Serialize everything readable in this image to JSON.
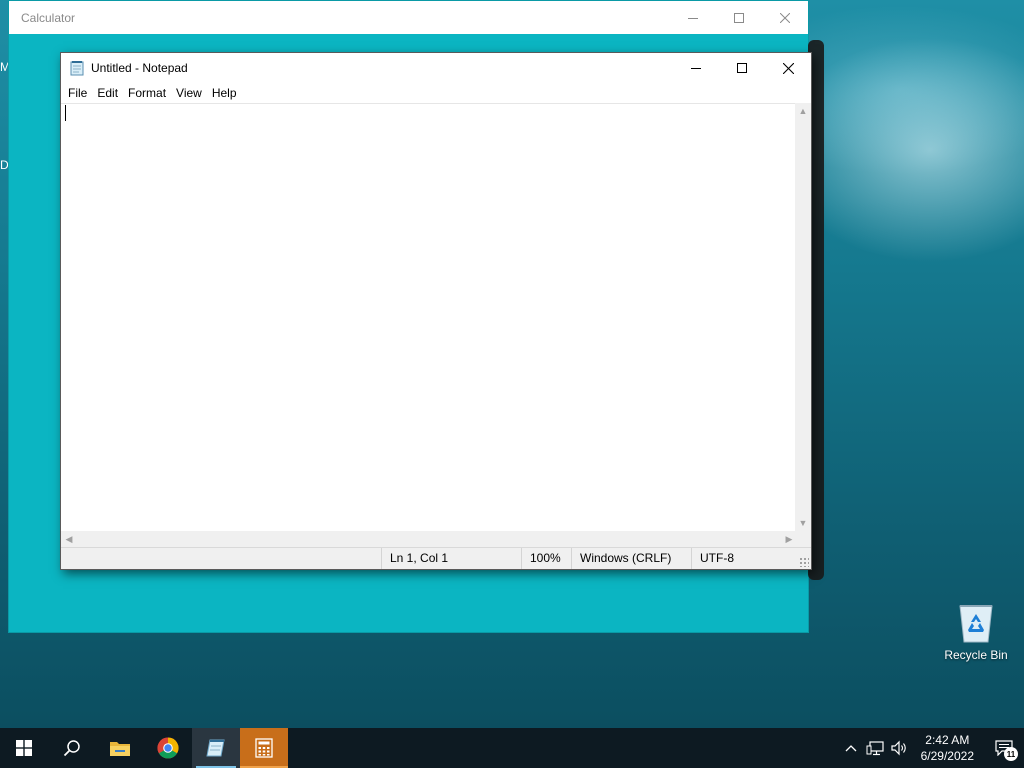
{
  "desktop": {
    "partial_labels": [
      "M",
      "D"
    ],
    "recycle_bin_label": "Recycle Bin"
  },
  "calculator": {
    "title": "Calculator",
    "accent": "#0bb5c2"
  },
  "notepad": {
    "title": "Untitled - Notepad",
    "menu": [
      "File",
      "Edit",
      "Format",
      "View",
      "Help"
    ],
    "content": "",
    "status": {
      "position": "Ln 1, Col 1",
      "zoom": "100%",
      "line_endings": "Windows (CRLF)",
      "encoding": "UTF-8"
    }
  },
  "taskbar": {
    "apps": [
      "start-icon",
      "search-icon",
      "file-explorer-icon",
      "chrome-icon",
      "notepad-icon",
      "calculator-icon"
    ],
    "time": "2:42 AM",
    "date": "6/29/2022",
    "notification_count": "11"
  }
}
